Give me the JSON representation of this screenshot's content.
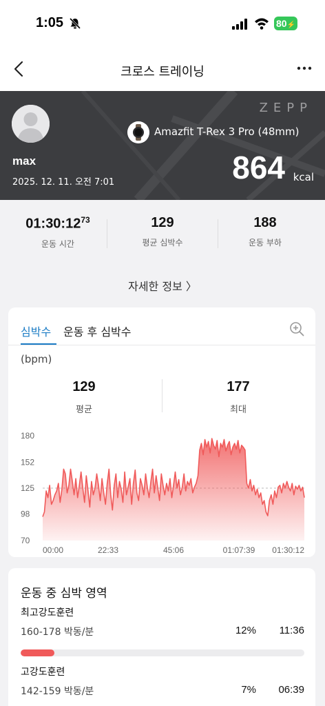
{
  "status": {
    "time": "1:05",
    "battery": "80"
  },
  "nav": {
    "title": "크로스 트레이닝"
  },
  "header": {
    "brand": "ZEPP",
    "user": "max",
    "datetime": "2025. 12. 11. 오전 7:01",
    "device": "Amazfit T-Rex 3 Pro (48mm)",
    "calories": "864",
    "calories_unit": "kcal"
  },
  "summary": {
    "duration_main": "01:30:12",
    "duration_frac": "73",
    "duration_label": "운동 시간",
    "avg_hr": "129",
    "avg_hr_label": "평균 심박수",
    "load": "188",
    "load_label": "운동 부하",
    "detail_link": "자세한 정보 〉"
  },
  "heart_card": {
    "tab_active": "심박수",
    "tab_inactive": "운동 후 심박수",
    "unit": "(bpm)",
    "avg_value": "129",
    "avg_label": "평균",
    "max_value": "177",
    "max_label": "최대",
    "accent": "#1a7bc4"
  },
  "chart_data": {
    "type": "area",
    "ylim": [
      70,
      180
    ],
    "yticks": [
      "180",
      "152",
      "125",
      "98",
      "70"
    ],
    "xticks": [
      "00:00",
      "22:33",
      "45:06",
      "01:07:39",
      "01:30:12"
    ],
    "reference_line": 125,
    "color": "#f05a5a",
    "series": [
      {
        "values": [
          95,
          100,
          122,
          115,
          128,
          108,
          112,
          118,
          122,
          130,
          110,
          124,
          145,
          140,
          120,
          128,
          145,
          132,
          118,
          135,
          115,
          128,
          142,
          125,
          110,
          138,
          122,
          105,
          132,
          118,
          125,
          140,
          128,
          112,
          135,
          120,
          108,
          130,
          145,
          118,
          102,
          128,
          140,
          115,
          132,
          124,
          110,
          142,
          118,
          126,
          135,
          108,
          130,
          144,
          120,
          112,
          135,
          128,
          118,
          140,
          126,
          115,
          132,
          145,
          120,
          138,
          125,
          112,
          140,
          128,
          118,
          130,
          122,
          135,
          115,
          128,
          142,
          125,
          134,
          118,
          126,
          140,
          122,
          132,
          128,
          135,
          120,
          126,
          130,
          138,
          165,
          172,
          160,
          176,
          168,
          174,
          162,
          177,
          170,
          166,
          175,
          158,
          172,
          168,
          176,
          164,
          170,
          174,
          160,
          168,
          172,
          166,
          175,
          162,
          170,
          168,
          165,
          130,
          125,
          134,
          122,
          128,
          118,
          124,
          115,
          120,
          108,
          112,
          100,
          96,
          112,
          118,
          108,
          122,
          115,
          126,
          128,
          120,
          130,
          125,
          132,
          126,
          122,
          130,
          118,
          127,
          124,
          128,
          122,
          126,
          115
        ]
      }
    ]
  },
  "zones": {
    "title": "운동 중 심박 영역",
    "items": [
      {
        "name": "최고강도훈련",
        "range": "160-178 박동/분",
        "pct": "12%",
        "duration": "11:36",
        "fraction": 0.12,
        "color": "#f05a5a"
      },
      {
        "name": "고강도훈련",
        "range": "142-159 박동/분",
        "pct": "7%",
        "duration": "06:39",
        "fraction": 0.07,
        "color": "#f4b619"
      }
    ]
  }
}
